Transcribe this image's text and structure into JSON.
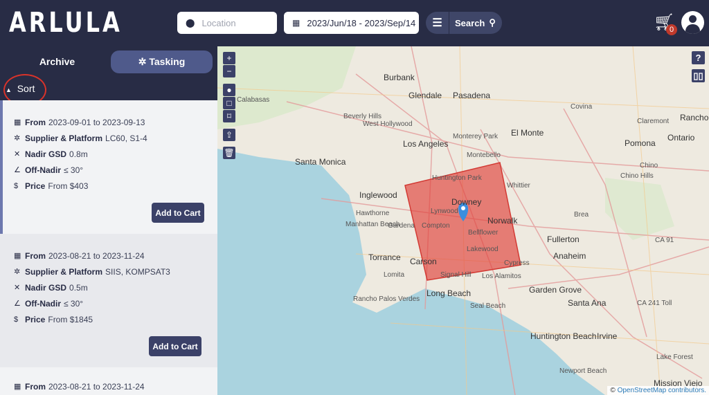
{
  "header": {
    "logo": "ARLULA",
    "location_placeholder": "Location",
    "date_range": "2023/Jun/18 - 2023/Sep/14",
    "search_label": "Search",
    "cart_count": "0"
  },
  "sidebar": {
    "tabs": [
      {
        "label": "Archive",
        "active": false
      },
      {
        "label": "Tasking",
        "active": true
      }
    ],
    "sort_label": "Sort",
    "cards": [
      {
        "from_label": "From",
        "dates": "2023-09-01 to 2023-09-13",
        "supplier_label": "Supplier & Platform",
        "supplier": "LC60, S1-4",
        "gsd_label": "Nadir GSD",
        "gsd": "0.8m",
        "offnadir_label": "Off-Nadir",
        "offnadir": "≤ 30°",
        "price_label": "Price",
        "price": "From $403",
        "button": "Add to Cart"
      },
      {
        "from_label": "From",
        "dates": "2023-08-21 to 2023-11-24",
        "supplier_label": "Supplier & Platform",
        "supplier": "SIIS, KOMPSAT3",
        "gsd_label": "Nadir GSD",
        "gsd": "0.5m",
        "offnadir_label": "Off-Nadir",
        "offnadir": "≤ 30°",
        "price_label": "Price",
        "price": "From $1845",
        "button": "Add to Cart"
      },
      {
        "from_label": "From",
        "dates": "2023-08-21 to 2023-11-24"
      }
    ]
  },
  "map": {
    "controls": [
      "+",
      "−"
    ],
    "help": "?",
    "aoi_color": "#e0413a",
    "attribution_link": "OpenStreetMap",
    "attribution_text": " contributors.",
    "places": [
      "Burbank",
      "Glendale",
      "Pasadena",
      "Calabasas",
      "Beverly Hills",
      "West Hollywood",
      "Los Angeles",
      "El Monte",
      "Santa Monica",
      "Monterey Park",
      "Montebello",
      "Pomona",
      "Ontario",
      "Inglewood",
      "Huntington Park",
      "Downey",
      "Whittier",
      "Hawthorne",
      "Lynwood",
      "Compton",
      "Norwalk",
      "Manhattan Beach",
      "Gardena",
      "Bellflower",
      "Fullerton",
      "Torrance",
      "Carson",
      "Lakewood",
      "Anaheim",
      "Cypress",
      "Long Beach",
      "Garden Grove",
      "Santa Ana",
      "Rancho Palos Verdes",
      "Seal Beach",
      "Huntington Beach",
      "Irvine",
      "Newport Beach",
      "Mission Viejo",
      "Chino Hills",
      "Brea",
      "Covina",
      "Claremont",
      "Rancho",
      "Chino",
      "Lomita",
      "Los Alamitos",
      "Signal Hill",
      "Lake Forest",
      "CA 91",
      "CA 241 Toll"
    ]
  }
}
